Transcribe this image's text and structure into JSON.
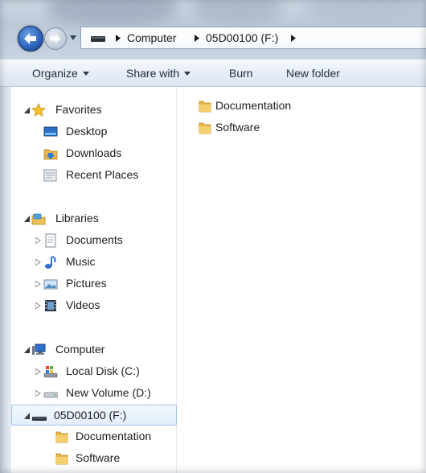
{
  "address": {
    "crumbs": [
      "Computer",
      "05D00100 (F:)"
    ]
  },
  "toolbar": {
    "organize": "Organize",
    "share_with": "Share with",
    "burn": "Burn",
    "new_folder": "New folder"
  },
  "nav": {
    "favorites": {
      "label": "Favorites",
      "items": [
        "Desktop",
        "Downloads",
        "Recent Places"
      ]
    },
    "libraries": {
      "label": "Libraries",
      "items": [
        "Documents",
        "Music",
        "Pictures",
        "Videos"
      ]
    },
    "computer": {
      "label": "Computer",
      "drives": [
        "Local Disk (C:)",
        "New Volume (D:)",
        "05D00100 (F:)"
      ],
      "selected_drive_children": [
        "Documentation",
        "Software"
      ]
    }
  },
  "content": {
    "items": [
      "Documentation",
      "Software"
    ]
  },
  "colors": {
    "folder": "#e8b64a",
    "selection_border": "#9fc3e8",
    "back_button": "#2d66bd"
  },
  "icons": {
    "back": "back-arrow-icon",
    "forward": "forward-arrow-icon",
    "folder": "folder-icon",
    "drive": "drive-icon",
    "star": "star-icon"
  }
}
